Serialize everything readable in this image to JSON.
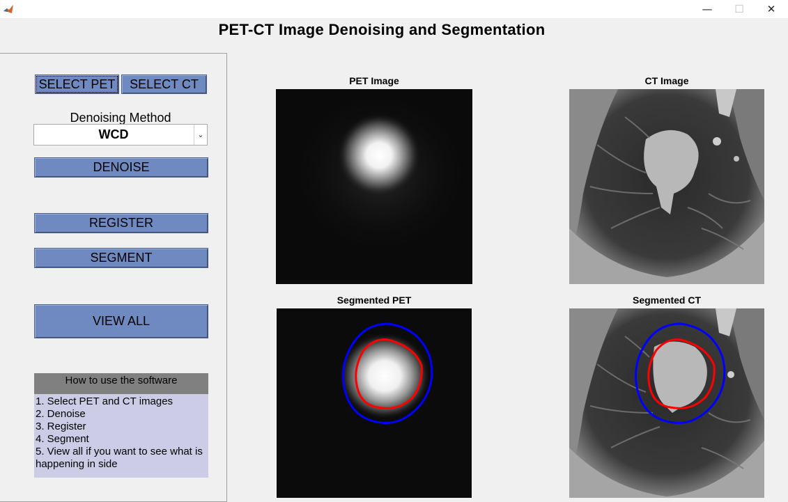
{
  "window": {
    "minimize_glyph": "—",
    "maximize_glyph": "☐",
    "close_glyph": "✕",
    "icon": "matlab-icon"
  },
  "title": "PET-CT Image Denoising and Segmentation",
  "controls": {
    "select_pet": "SELECT PET",
    "select_ct": "SELECT CT",
    "denoising_label": "Denoising Method",
    "denoising_value": "WCD",
    "denoise": "DENOISE",
    "register": "REGISTER",
    "segment": "SEGMENT",
    "view_all": "VIEW ALL"
  },
  "help": {
    "header": "How to use the software",
    "steps": [
      "1. Select PET and CT images",
      "2. Denoise",
      "3. Register",
      "4. Segment",
      "5. View all if you want to see what is happening in side"
    ]
  },
  "images": {
    "pet": "PET Image",
    "ct": "CT Image",
    "seg_pet": "Segmented PET",
    "seg_ct": "Segmented CT"
  },
  "colors": {
    "button": "#6f89c1",
    "help_header": "#808080",
    "help_body": "#cccce6",
    "contour_outer": "#0000ff",
    "contour_inner": "#ff0000"
  }
}
